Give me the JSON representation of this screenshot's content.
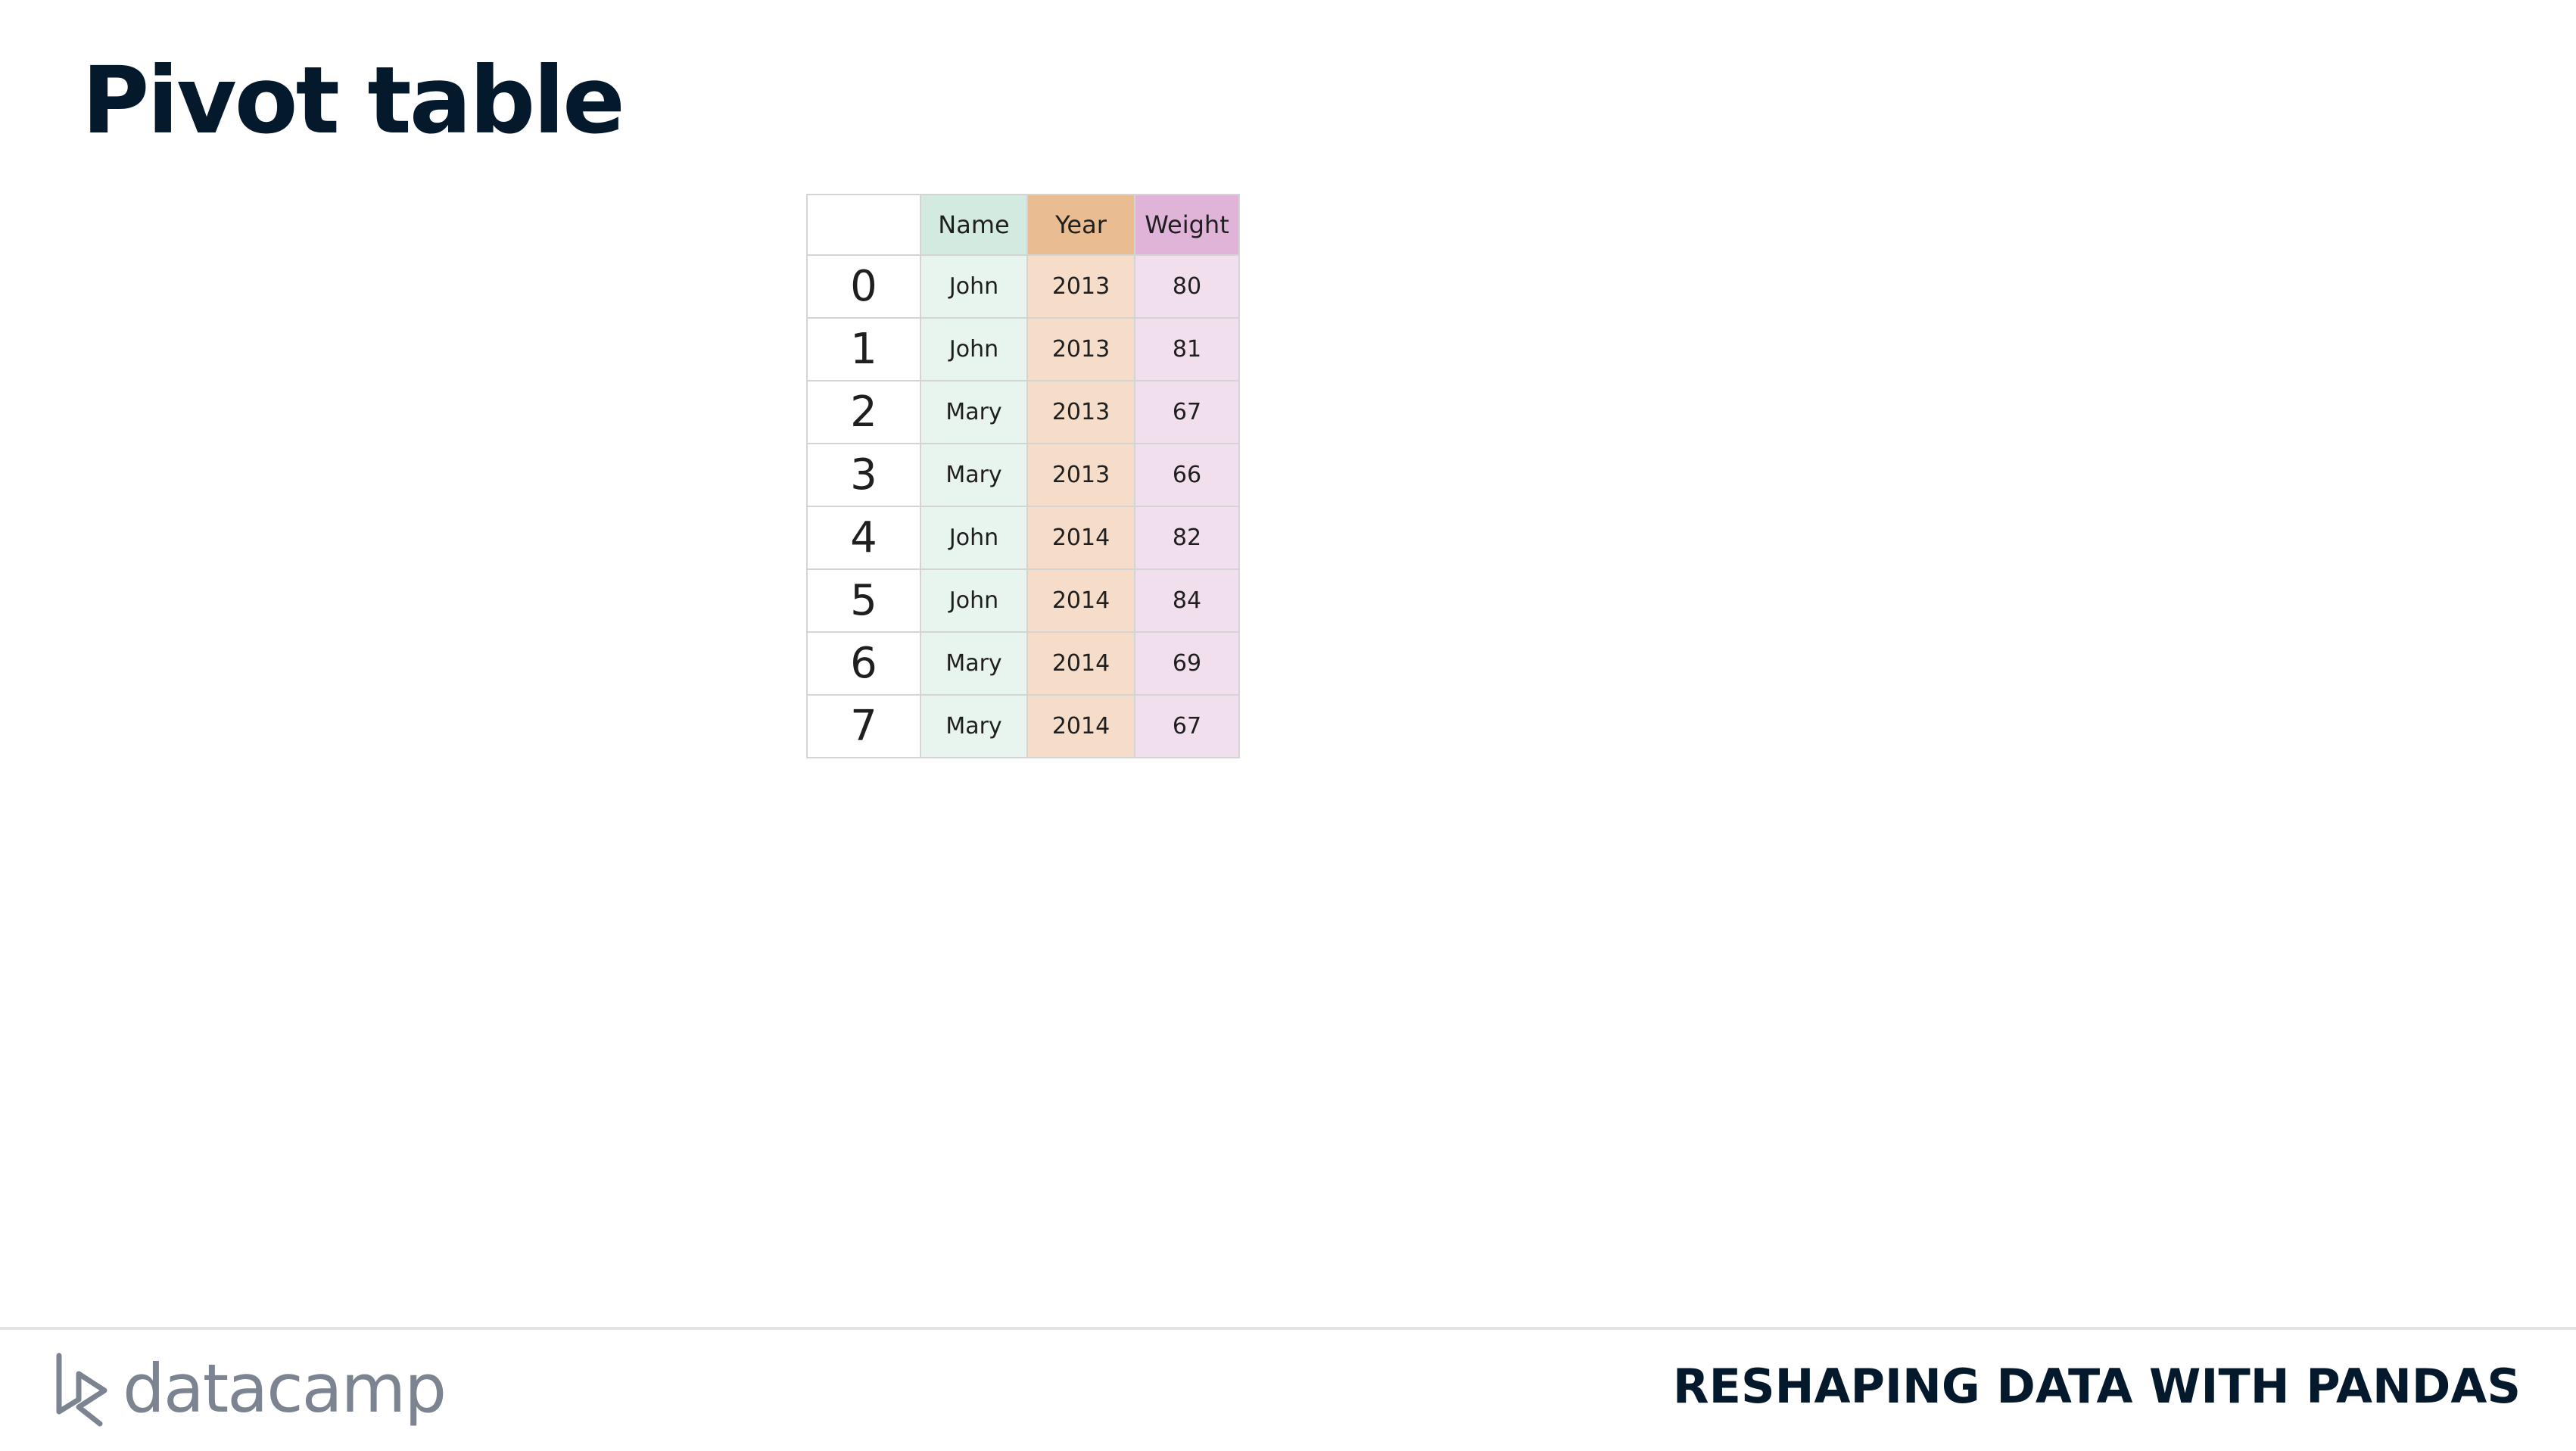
{
  "slide": {
    "title": "Pivot table"
  },
  "table": {
    "headers": [
      "Name",
      "Year",
      "Weight"
    ],
    "rows": [
      {
        "index": "0",
        "name": "John",
        "year": "2013",
        "weight": "80"
      },
      {
        "index": "1",
        "name": "John",
        "year": "2013",
        "weight": "81"
      },
      {
        "index": "2",
        "name": "Mary",
        "year": "2013",
        "weight": "67"
      },
      {
        "index": "3",
        "name": "Mary",
        "year": "2013",
        "weight": "66"
      },
      {
        "index": "4",
        "name": "John",
        "year": "2014",
        "weight": "82"
      },
      {
        "index": "5",
        "name": "John",
        "year": "2014",
        "weight": "84"
      },
      {
        "index": "6",
        "name": "Mary",
        "year": "2014",
        "weight": "69"
      },
      {
        "index": "7",
        "name": "Mary",
        "year": "2014",
        "weight": "67"
      }
    ],
    "colors": {
      "name_header": "#d2eadf",
      "year_header": "#e9bc92",
      "weight_header": "#e0b3d8"
    }
  },
  "footer": {
    "logo_text": "datacamp",
    "logo_icon": "datacamp-logo-icon",
    "course_title": "RESHAPING DATA WITH PANDAS"
  }
}
